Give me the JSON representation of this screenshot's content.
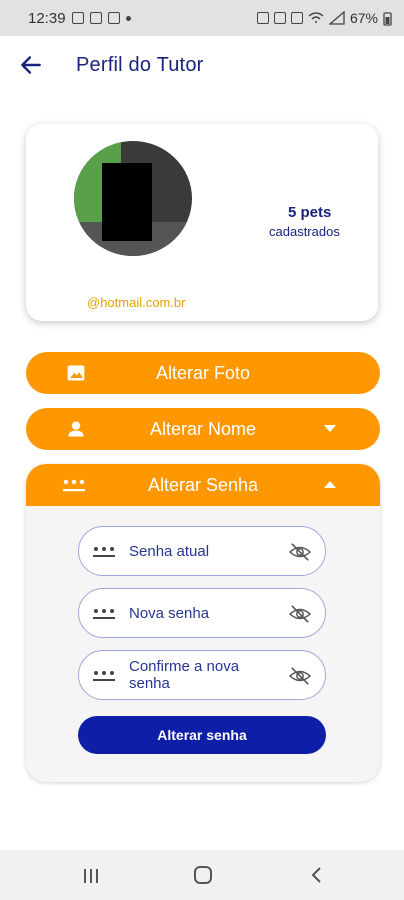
{
  "status_bar": {
    "time": "12:39",
    "battery": "67%"
  },
  "app_bar": {
    "title": "Perfil do Tutor"
  },
  "profile": {
    "pets_count": "5 pets",
    "pets_label": "cadastrados",
    "email": "@hotmail.com.br"
  },
  "actions": {
    "change_photo": "Alterar Foto",
    "change_name": "Alterar Nome",
    "change_password": "Alterar Senha"
  },
  "password_form": {
    "current": "Senha atual",
    "new": "Nova senha",
    "confirm": "Confirme a nova senha",
    "submit": "Alterar senha"
  },
  "colors": {
    "accent": "#ff9800",
    "primary": "#1a237e",
    "submit": "#0d1fa6",
    "email": "#e6a100"
  },
  "icons": {
    "back": "arrow-left-icon",
    "photo": "image-icon",
    "name": "person-icon",
    "password": "password-dots-icon",
    "expand": "chevron-down-icon",
    "collapse": "chevron-up-icon",
    "visibility": "eye-off-icon"
  }
}
